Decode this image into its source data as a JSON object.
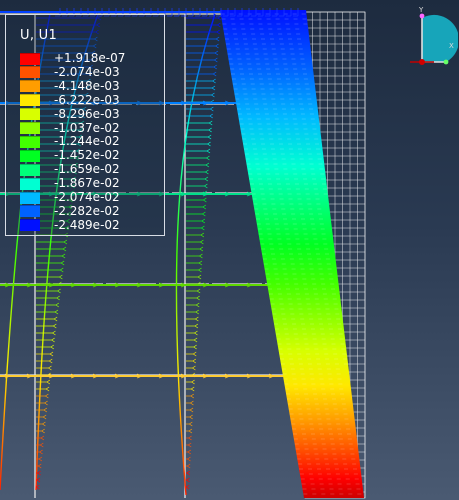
{
  "legend": {
    "title": "U, U1",
    "entries": [
      {
        "label": "+1.918e-07",
        "color": "#ff0000"
      },
      {
        "label": "-2.074e-03",
        "color": "#ff5200"
      },
      {
        "label": "-4.148e-03",
        "color": "#ff9d00"
      },
      {
        "label": "-6.222e-03",
        "color": "#ffe800"
      },
      {
        "label": "-8.296e-03",
        "color": "#d8ff00"
      },
      {
        "label": "-1.037e-02",
        "color": "#8dff00"
      },
      {
        "label": "-1.244e-02",
        "color": "#42ff00"
      },
      {
        "label": "-1.452e-02",
        "color": "#00ff22"
      },
      {
        "label": "-1.659e-02",
        "color": "#00ff7a"
      },
      {
        "label": "-1.867e-02",
        "color": "#00ffd2"
      },
      {
        "label": "-2.074e-02",
        "color": "#00baff"
      },
      {
        "label": "-2.282e-02",
        "color": "#0062ff"
      },
      {
        "label": "-2.489e-02",
        "color": "#0010ff"
      }
    ]
  },
  "triad": {
    "y_label": "Y",
    "x_label": "X"
  }
}
